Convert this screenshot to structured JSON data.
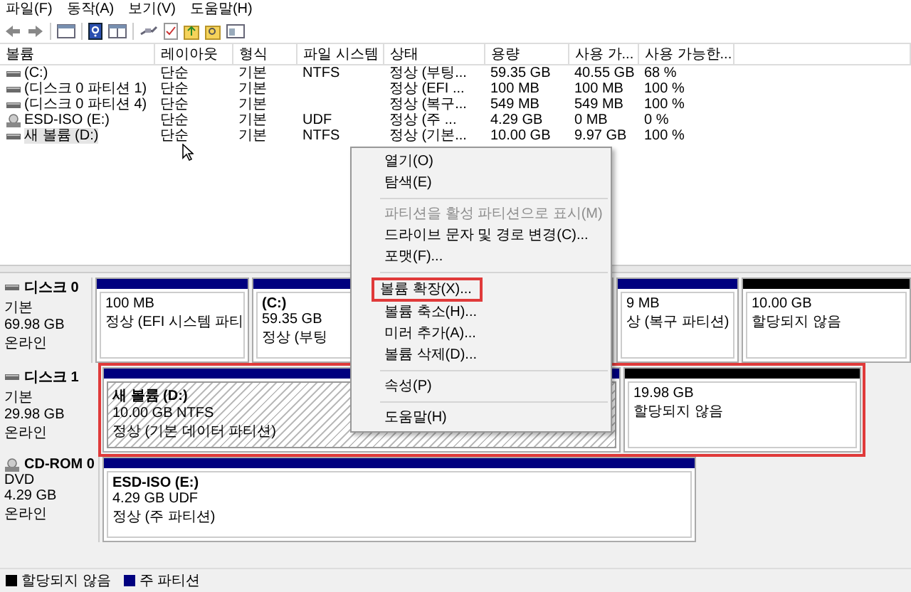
{
  "menubar": [
    "파일(F)",
    "동작(A)",
    "보기(V)",
    "도움말(H)"
  ],
  "volume_table": {
    "columns": [
      "볼륨",
      "레이아웃",
      "형식",
      "파일 시스템",
      "상태",
      "용량",
      "사용 가...",
      "사용 가능한..."
    ],
    "rows": [
      {
        "kind": "disk",
        "selected": false,
        "cells": [
          "(C:)",
          "단순",
          "기본",
          "NTFS",
          "정상 (부팅...",
          "59.35 GB",
          "40.55 GB",
          "68 %"
        ]
      },
      {
        "kind": "disk",
        "selected": false,
        "cells": [
          "(디스크 0 파티션 1)",
          "단순",
          "기본",
          "",
          "정상 (EFI ...",
          "100 MB",
          "100 MB",
          "100 %"
        ]
      },
      {
        "kind": "disk",
        "selected": false,
        "cells": [
          "(디스크 0 파티션 4)",
          "단순",
          "기본",
          "",
          "정상 (복구...",
          "549 MB",
          "549 MB",
          "100 %"
        ]
      },
      {
        "kind": "cd",
        "selected": false,
        "cells": [
          "ESD-ISO (E:)",
          "단순",
          "기본",
          "UDF",
          "정상 (주 ...",
          "4.29 GB",
          "0 MB",
          "0 %"
        ]
      },
      {
        "kind": "disk",
        "selected": true,
        "cells": [
          "새 볼륨 (D:)",
          "단순",
          "기본",
          "NTFS",
          "정상 (기본...",
          "10.00 GB",
          "9.97 GB",
          "100 %"
        ]
      }
    ]
  },
  "disks": [
    {
      "kind": "disk",
      "name": "디스크 0",
      "type": "기본",
      "size": "69.98 GB",
      "status": "온라인",
      "annotated": false,
      "partitions": [
        {
          "kind": "primary",
          "selected": false,
          "lines": [
            "100 MB",
            "정상 (EFI 시스템 파티"
          ]
        },
        {
          "kind": "primary",
          "selected": false,
          "title": "(C:)",
          "lines": [
            "59.35 GB",
            "정상 (부팅"
          ]
        },
        {
          "kind": "primary",
          "selected": false,
          "lines": [
            "9 MB",
            "상 (복구 파티션)"
          ]
        },
        {
          "kind": "unallocated",
          "selected": false,
          "lines": [
            "10.00 GB",
            "할당되지 않음"
          ]
        }
      ]
    },
    {
      "kind": "disk",
      "name": "디스크 1",
      "type": "기본",
      "size": "29.98 GB",
      "status": "온라인",
      "annotated": true,
      "partitions": [
        {
          "kind": "primary",
          "selected": true,
          "title": "새 볼륨  (D:)",
          "lines": [
            "10.00 GB NTFS",
            "정상 (기본 데이터 파티션)"
          ]
        },
        {
          "kind": "unallocated",
          "selected": false,
          "lines": [
            "19.98 GB",
            "할당되지 않음"
          ]
        }
      ]
    },
    {
      "kind": "cd",
      "name": "CD-ROM 0",
      "type": "DVD",
      "size": "4.29 GB",
      "status": "온라인",
      "annotated": false,
      "partitions": [
        {
          "kind": "primary",
          "selected": false,
          "title": "ESD-ISO  (E:)",
          "lines": [
            "4.29 GB UDF",
            "정상 (주 파티션)"
          ]
        }
      ]
    }
  ],
  "context_menu": [
    {
      "kind": "item",
      "label": "열기(O)",
      "disabled": false,
      "annotated": false
    },
    {
      "kind": "item",
      "label": "탐색(E)",
      "disabled": false,
      "annotated": false
    },
    {
      "kind": "separator"
    },
    {
      "kind": "item",
      "label": "파티션을 활성 파티션으로 표시(M)",
      "disabled": true,
      "annotated": false
    },
    {
      "kind": "item",
      "label": "드라이브 문자 및 경로 변경(C)...",
      "disabled": false,
      "annotated": false
    },
    {
      "kind": "item",
      "label": "포맷(F)...",
      "disabled": false,
      "annotated": false
    },
    {
      "kind": "separator"
    },
    {
      "kind": "item",
      "label": "볼륨 확장(X)...",
      "disabled": false,
      "annotated": true
    },
    {
      "kind": "item",
      "label": "볼륨 축소(H)...",
      "disabled": false,
      "annotated": false
    },
    {
      "kind": "item",
      "label": "미러 추가(A)...",
      "disabled": false,
      "annotated": false
    },
    {
      "kind": "item",
      "label": "볼륨 삭제(D)...",
      "disabled": false,
      "annotated": false
    },
    {
      "kind": "separator"
    },
    {
      "kind": "item",
      "label": "속성(P)",
      "disabled": false,
      "annotated": false
    },
    {
      "kind": "separator"
    },
    {
      "kind": "item",
      "label": "도움말(H)",
      "disabled": false,
      "annotated": false
    }
  ],
  "legend": [
    {
      "label": "할당되지 않음",
      "color": "#000000"
    },
    {
      "label": "주 파티션",
      "color": "#00007f"
    }
  ]
}
